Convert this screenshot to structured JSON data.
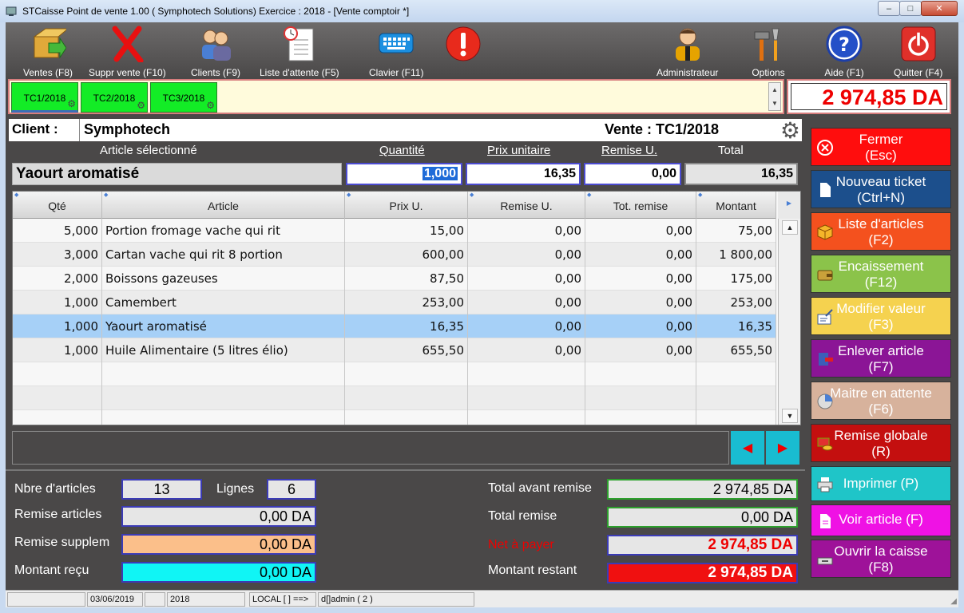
{
  "window": {
    "title": "STCaisse Point de vente 1.00 ( Symphotech Solutions) Exercice : 2018 - [Vente comptoir  *]",
    "minimize": "–",
    "maximize": "□",
    "close": "✕"
  },
  "toolbar": {
    "ventes": "Ventes (F8)",
    "suppr_vente": "Suppr vente (F10)",
    "clients": "Clients (F9)",
    "liste_attente": "Liste d'attente (F5)",
    "clavier": "Clavier (F11)",
    "administrateur": "Administrateur",
    "options": "Options",
    "aide": "Aide (F1)",
    "quitter": "Quitter (F4)"
  },
  "tabs": [
    {
      "label": "TC1/2018"
    },
    {
      "label": "TC2/2018"
    },
    {
      "label": "TC3/2018"
    }
  ],
  "big_total": "2 974,85 DA",
  "client": {
    "label": "Client :",
    "name": "Symphotech",
    "vente_label": "Vente :  TC1/2018"
  },
  "selection": {
    "hdr_article": "Article sélectionné",
    "hdr_quantite": "Quantité",
    "hdr_prix": "Prix unitaire",
    "hdr_remise": "Remise U.",
    "hdr_total": "Total",
    "article": "Yaourt aromatisé",
    "quantite": "1,000",
    "prix": "16,35",
    "remise": "0,00",
    "total": "16,35"
  },
  "grid": {
    "headers": [
      "Qté",
      "Article",
      "Prix U.",
      "Remise U.",
      "Tot. remise",
      "Montant"
    ],
    "rows": [
      [
        "5,000",
        "Portion fromage vache qui rit",
        "15,00",
        "0,00",
        "0,00",
        "75,00"
      ],
      [
        "3,000",
        "Cartan vache qui rit 8 portion",
        "600,00",
        "0,00",
        "0,00",
        "1 800,00"
      ],
      [
        "2,000",
        "Boissons gazeuses",
        "87,50",
        "0,00",
        "0,00",
        "175,00"
      ],
      [
        "1,000",
        "Camembert",
        "253,00",
        "0,00",
        "0,00",
        "253,00"
      ],
      [
        "1,000",
        "Yaourt aromatisé",
        "16,35",
        "0,00",
        "0,00",
        "16,35"
      ],
      [
        "1,000",
        "Huile Alimentaire (5 litres élio)",
        "655,50",
        "0,00",
        "0,00",
        "655,50"
      ]
    ],
    "selected_row": 4
  },
  "summary": {
    "nbre_articles_label": "Nbre d'articles",
    "nbre_articles": "13",
    "lignes_label": "Lignes",
    "lignes": "6",
    "remise_articles_label": "Remise articles",
    "remise_articles": "0,00 DA",
    "remise_supplem_label": "Remise supplem",
    "remise_supplem": "0,00 DA",
    "montant_recu_label": "Montant reçu",
    "montant_recu": "0,00 DA",
    "total_avant_remise_label": "Total avant remise",
    "total_avant_remise": "2 974,85 DA",
    "total_remise_label": "Total remise",
    "total_remise": "0,00 DA",
    "net_a_payer_label": "Net à payer",
    "net_a_payer": "2 974,85 DA",
    "montant_restant_label": "Montant restant",
    "montant_restant": "2 974,85 DA"
  },
  "sidebar": {
    "fermer": [
      "Fermer",
      "(Esc)"
    ],
    "nouveau": [
      "Nouveau ticket",
      "(Ctrl+N)"
    ],
    "liste": [
      "Liste d'articles",
      "(F2)"
    ],
    "encaissement": [
      "Encaissement",
      "(F12)"
    ],
    "modifier": [
      "Modifier valeur",
      "(F3)"
    ],
    "enlever": [
      "Enlever article",
      "(F7)"
    ],
    "maitre": [
      "Maitre en attente",
      "(F6)"
    ],
    "remise": [
      "Remise globale",
      "(R)"
    ],
    "imprimer": "Imprimer (P)",
    "voir": "Voir article (F)",
    "ouvrir": [
      "Ouvrir la caisse",
      "(F8)"
    ]
  },
  "status": {
    "date": "03/06/2019",
    "year": "2018",
    "local": "LOCAL [  ] ==>",
    "user": "d[]admin ( 2 )"
  },
  "colors": {
    "fermer": "#ff0d0d",
    "nouveau": "#1c4f8c",
    "liste": "#f4511e",
    "encaissement": "#8bc34a",
    "modifier": "#f5d24f",
    "enlever": "#8b1596",
    "maitre": "#d7b29c",
    "remise": "#c40f0f",
    "imprimer": "#1fc5c8",
    "voir": "#ef12e4",
    "ouvrir": "#9e1299"
  }
}
